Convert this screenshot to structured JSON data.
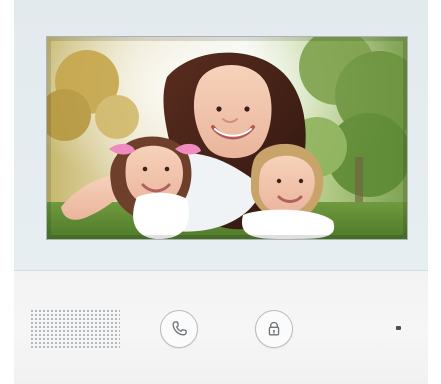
{
  "device": {
    "colors": {
      "bezel": "#e6edf0",
      "panel": "#f5f5f5",
      "button_stroke": "#b7bcbf",
      "icon": "#6e7478"
    }
  },
  "screen": {
    "content": "family-photo"
  },
  "controls": {
    "call_button_icon": "phone-handset-icon",
    "unlock_button_icon": "padlock-icon"
  }
}
